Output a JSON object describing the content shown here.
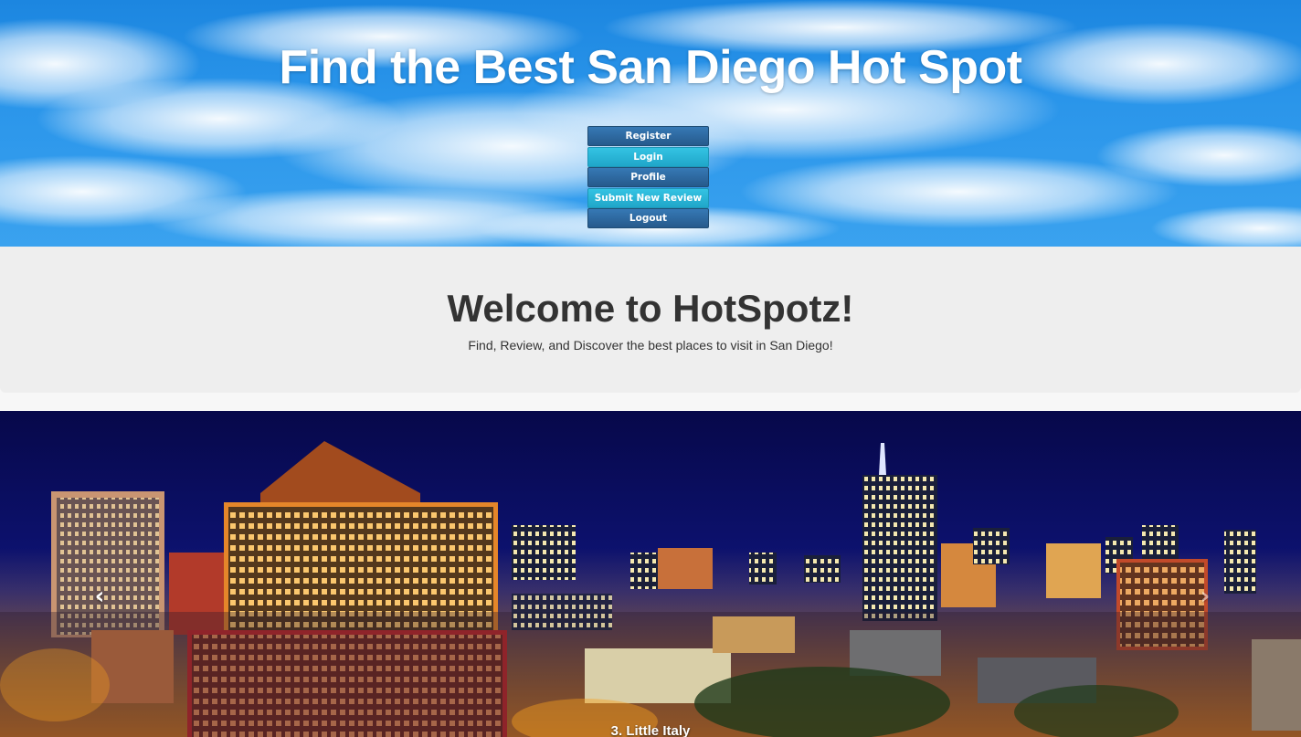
{
  "header": {
    "title": "Find the Best San Diego Hot Spot",
    "nav_buttons": [
      {
        "label": "Register",
        "style": "primary"
      },
      {
        "label": "Login",
        "style": "info"
      },
      {
        "label": "Profile",
        "style": "primary"
      },
      {
        "label": "Submit New Review",
        "style": "info"
      },
      {
        "label": "Logout",
        "style": "primary"
      }
    ]
  },
  "welcome": {
    "title": "Welcome to HotSpotz!",
    "subtitle": "Find, Review, and Discover the best places to visit in San Diego!"
  },
  "carousel": {
    "caption": "3. Little Italy",
    "prev_icon": "chevron-left-icon",
    "next_icon": "chevron-right-icon",
    "prev_glyph": "‹",
    "next_glyph": "›"
  },
  "colors": {
    "btn_primary": "#2b669e",
    "btn_info": "#2ab4d6",
    "jumbotron_bg": "#eeeeee",
    "sky": "#2a95ea",
    "night_sky": "#0b0c5a"
  }
}
